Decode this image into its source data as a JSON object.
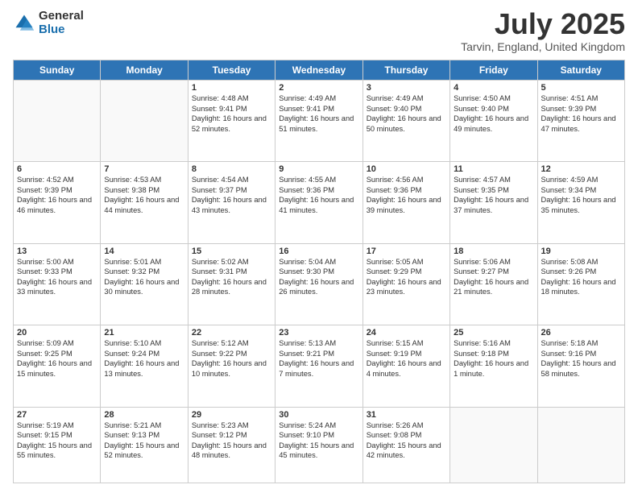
{
  "logo": {
    "general": "General",
    "blue": "Blue"
  },
  "header": {
    "month": "July 2025",
    "location": "Tarvin, England, United Kingdom"
  },
  "days": [
    "Sunday",
    "Monday",
    "Tuesday",
    "Wednesday",
    "Thursday",
    "Friday",
    "Saturday"
  ],
  "weeks": [
    [
      {
        "day": "",
        "sunrise": "",
        "sunset": "",
        "daylight": ""
      },
      {
        "day": "",
        "sunrise": "",
        "sunset": "",
        "daylight": ""
      },
      {
        "day": "1",
        "sunrise": "Sunrise: 4:48 AM",
        "sunset": "Sunset: 9:41 PM",
        "daylight": "Daylight: 16 hours and 52 minutes."
      },
      {
        "day": "2",
        "sunrise": "Sunrise: 4:49 AM",
        "sunset": "Sunset: 9:41 PM",
        "daylight": "Daylight: 16 hours and 51 minutes."
      },
      {
        "day": "3",
        "sunrise": "Sunrise: 4:49 AM",
        "sunset": "Sunset: 9:40 PM",
        "daylight": "Daylight: 16 hours and 50 minutes."
      },
      {
        "day": "4",
        "sunrise": "Sunrise: 4:50 AM",
        "sunset": "Sunset: 9:40 PM",
        "daylight": "Daylight: 16 hours and 49 minutes."
      },
      {
        "day": "5",
        "sunrise": "Sunrise: 4:51 AM",
        "sunset": "Sunset: 9:39 PM",
        "daylight": "Daylight: 16 hours and 47 minutes."
      }
    ],
    [
      {
        "day": "6",
        "sunrise": "Sunrise: 4:52 AM",
        "sunset": "Sunset: 9:39 PM",
        "daylight": "Daylight: 16 hours and 46 minutes."
      },
      {
        "day": "7",
        "sunrise": "Sunrise: 4:53 AM",
        "sunset": "Sunset: 9:38 PM",
        "daylight": "Daylight: 16 hours and 44 minutes."
      },
      {
        "day": "8",
        "sunrise": "Sunrise: 4:54 AM",
        "sunset": "Sunset: 9:37 PM",
        "daylight": "Daylight: 16 hours and 43 minutes."
      },
      {
        "day": "9",
        "sunrise": "Sunrise: 4:55 AM",
        "sunset": "Sunset: 9:36 PM",
        "daylight": "Daylight: 16 hours and 41 minutes."
      },
      {
        "day": "10",
        "sunrise": "Sunrise: 4:56 AM",
        "sunset": "Sunset: 9:36 PM",
        "daylight": "Daylight: 16 hours and 39 minutes."
      },
      {
        "day": "11",
        "sunrise": "Sunrise: 4:57 AM",
        "sunset": "Sunset: 9:35 PM",
        "daylight": "Daylight: 16 hours and 37 minutes."
      },
      {
        "day": "12",
        "sunrise": "Sunrise: 4:59 AM",
        "sunset": "Sunset: 9:34 PM",
        "daylight": "Daylight: 16 hours and 35 minutes."
      }
    ],
    [
      {
        "day": "13",
        "sunrise": "Sunrise: 5:00 AM",
        "sunset": "Sunset: 9:33 PM",
        "daylight": "Daylight: 16 hours and 33 minutes."
      },
      {
        "day": "14",
        "sunrise": "Sunrise: 5:01 AM",
        "sunset": "Sunset: 9:32 PM",
        "daylight": "Daylight: 16 hours and 30 minutes."
      },
      {
        "day": "15",
        "sunrise": "Sunrise: 5:02 AM",
        "sunset": "Sunset: 9:31 PM",
        "daylight": "Daylight: 16 hours and 28 minutes."
      },
      {
        "day": "16",
        "sunrise": "Sunrise: 5:04 AM",
        "sunset": "Sunset: 9:30 PM",
        "daylight": "Daylight: 16 hours and 26 minutes."
      },
      {
        "day": "17",
        "sunrise": "Sunrise: 5:05 AM",
        "sunset": "Sunset: 9:29 PM",
        "daylight": "Daylight: 16 hours and 23 minutes."
      },
      {
        "day": "18",
        "sunrise": "Sunrise: 5:06 AM",
        "sunset": "Sunset: 9:27 PM",
        "daylight": "Daylight: 16 hours and 21 minutes."
      },
      {
        "day": "19",
        "sunrise": "Sunrise: 5:08 AM",
        "sunset": "Sunset: 9:26 PM",
        "daylight": "Daylight: 16 hours and 18 minutes."
      }
    ],
    [
      {
        "day": "20",
        "sunrise": "Sunrise: 5:09 AM",
        "sunset": "Sunset: 9:25 PM",
        "daylight": "Daylight: 16 hours and 15 minutes."
      },
      {
        "day": "21",
        "sunrise": "Sunrise: 5:10 AM",
        "sunset": "Sunset: 9:24 PM",
        "daylight": "Daylight: 16 hours and 13 minutes."
      },
      {
        "day": "22",
        "sunrise": "Sunrise: 5:12 AM",
        "sunset": "Sunset: 9:22 PM",
        "daylight": "Daylight: 16 hours and 10 minutes."
      },
      {
        "day": "23",
        "sunrise": "Sunrise: 5:13 AM",
        "sunset": "Sunset: 9:21 PM",
        "daylight": "Daylight: 16 hours and 7 minutes."
      },
      {
        "day": "24",
        "sunrise": "Sunrise: 5:15 AM",
        "sunset": "Sunset: 9:19 PM",
        "daylight": "Daylight: 16 hours and 4 minutes."
      },
      {
        "day": "25",
        "sunrise": "Sunrise: 5:16 AM",
        "sunset": "Sunset: 9:18 PM",
        "daylight": "Daylight: 16 hours and 1 minute."
      },
      {
        "day": "26",
        "sunrise": "Sunrise: 5:18 AM",
        "sunset": "Sunset: 9:16 PM",
        "daylight": "Daylight: 15 hours and 58 minutes."
      }
    ],
    [
      {
        "day": "27",
        "sunrise": "Sunrise: 5:19 AM",
        "sunset": "Sunset: 9:15 PM",
        "daylight": "Daylight: 15 hours and 55 minutes."
      },
      {
        "day": "28",
        "sunrise": "Sunrise: 5:21 AM",
        "sunset": "Sunset: 9:13 PM",
        "daylight": "Daylight: 15 hours and 52 minutes."
      },
      {
        "day": "29",
        "sunrise": "Sunrise: 5:23 AM",
        "sunset": "Sunset: 9:12 PM",
        "daylight": "Daylight: 15 hours and 48 minutes."
      },
      {
        "day": "30",
        "sunrise": "Sunrise: 5:24 AM",
        "sunset": "Sunset: 9:10 PM",
        "daylight": "Daylight: 15 hours and 45 minutes."
      },
      {
        "day": "31",
        "sunrise": "Sunrise: 5:26 AM",
        "sunset": "Sunset: 9:08 PM",
        "daylight": "Daylight: 15 hours and 42 minutes."
      },
      {
        "day": "",
        "sunrise": "",
        "sunset": "",
        "daylight": ""
      },
      {
        "day": "",
        "sunrise": "",
        "sunset": "",
        "daylight": ""
      }
    ]
  ]
}
